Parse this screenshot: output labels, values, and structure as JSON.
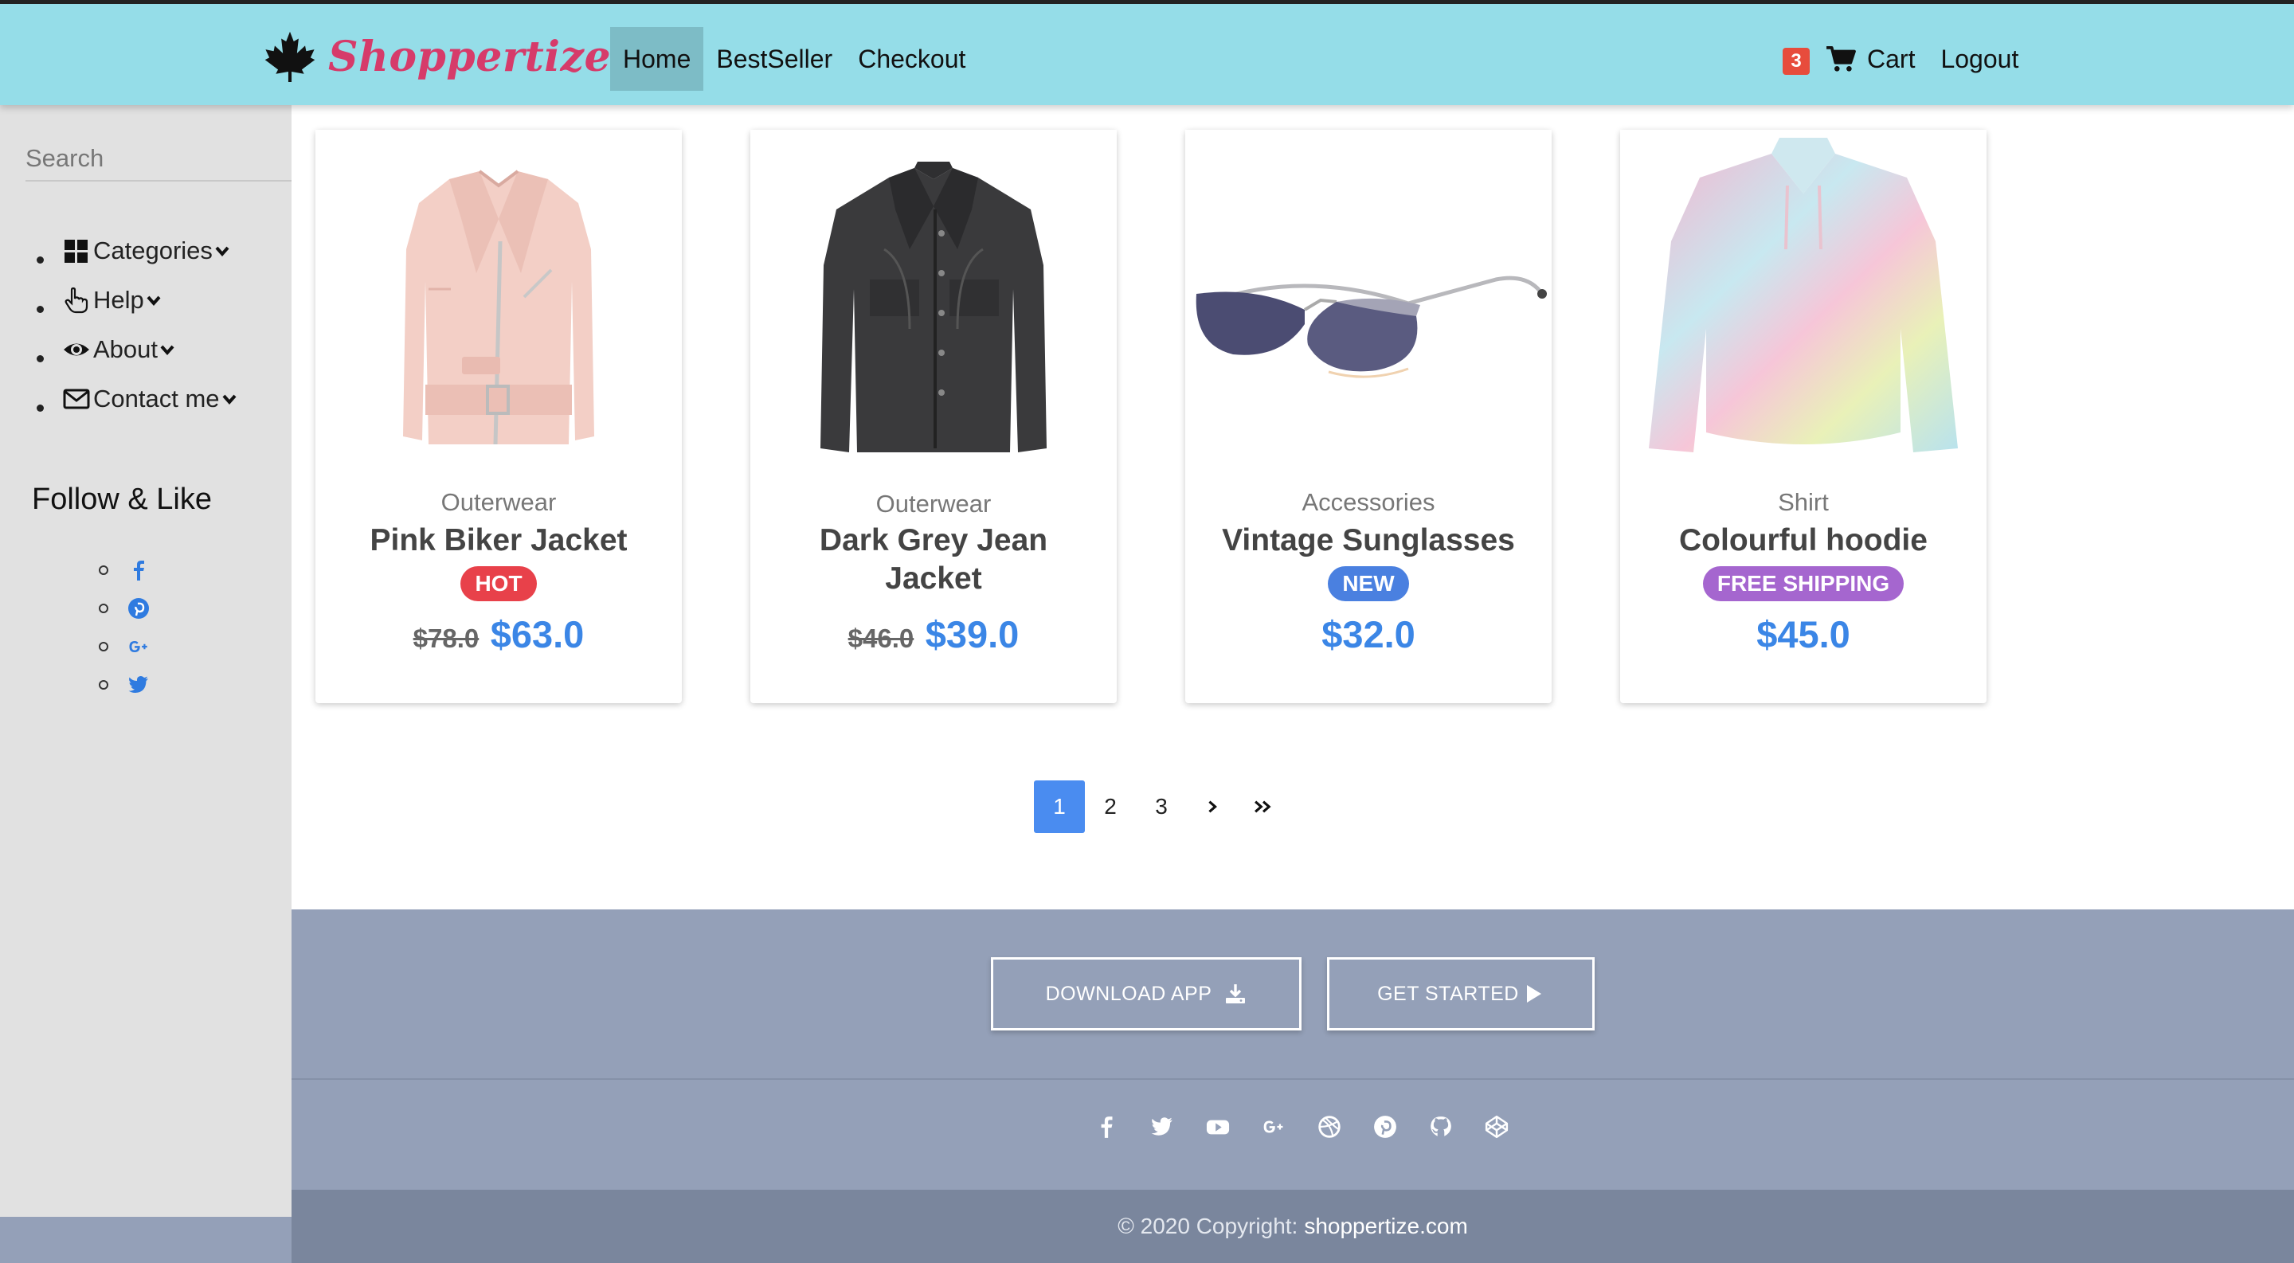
{
  "navbar": {
    "brand": "Shoppertize",
    "links": [
      {
        "label": "Home",
        "active": true
      },
      {
        "label": "BestSeller",
        "active": false
      },
      {
        "label": "Checkout",
        "active": false
      }
    ],
    "cart_count": "3",
    "cart_label": "Cart",
    "logout_label": "Logout",
    "colors": {
      "background": "#95dde8",
      "brand": "#d63b6a",
      "active": "#7dbcc6"
    }
  },
  "sidebar": {
    "search_placeholder": "Search",
    "menu": [
      {
        "label": "Categories",
        "icon": "grid-icon"
      },
      {
        "label": "Help",
        "icon": "hand-pointer-icon"
      },
      {
        "label": "About",
        "icon": "eye-icon"
      },
      {
        "label": "Contact me",
        "icon": "envelope-icon"
      }
    ],
    "follow_title": "Follow & Like",
    "social": [
      "facebook-icon",
      "pinterest-icon",
      "google-plus-icon",
      "twitter-icon"
    ]
  },
  "products": [
    {
      "category": "Outerwear",
      "name": "Pink Biker Jacket",
      "badge": "HOT",
      "badge_color": "#e8414a",
      "old_price": "$78.0",
      "price": "$63.0"
    },
    {
      "category": "Outerwear",
      "name": "Dark Grey Jean Jacket",
      "badge": "",
      "badge_color": "",
      "old_price": "$46.0",
      "price": "$39.0"
    },
    {
      "category": "Accessories",
      "name": "Vintage Sunglasses",
      "badge": "NEW",
      "badge_color": "#4a80e0",
      "old_price": "",
      "price": "$32.0"
    },
    {
      "category": "Shirt",
      "name": "Colourful hoodie",
      "badge": "FREE SHIPPING",
      "badge_color": "#a566cf",
      "old_price": "",
      "price": "$45.0"
    }
  ],
  "pagination": {
    "pages": [
      "1",
      "2",
      "3"
    ],
    "current": "1",
    "next": "›",
    "last": "»"
  },
  "footer": {
    "download_label": "DOWNLOAD APP",
    "started_label": "GET STARTED",
    "social": [
      "facebook-icon",
      "twitter-icon",
      "youtube-icon",
      "google-plus-icon",
      "dribbble-icon",
      "pinterest-icon",
      "github-icon",
      "codepen-icon"
    ],
    "copyright_prefix": "© 2020 Copyright:",
    "copyright_link": "shoppertize.com"
  }
}
